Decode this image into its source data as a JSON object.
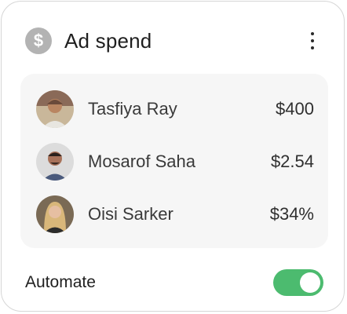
{
  "card": {
    "title": "Ad spend",
    "title_icon": "dollar-icon",
    "menu_icon": "more-vertical-icon"
  },
  "rows": [
    {
      "name": "Tasfiya Ray",
      "amount": "$400"
    },
    {
      "name": "Mosarof Saha",
      "amount": "$2.54"
    },
    {
      "name": "Oisi Sarker",
      "amount": "$34%"
    }
  ],
  "footer": {
    "label": "Automate",
    "toggle_on": true
  },
  "colors": {
    "accent_green": "#4cbb6f",
    "icon_gray": "#b3b3b3",
    "list_background": "#f6f6f6"
  }
}
